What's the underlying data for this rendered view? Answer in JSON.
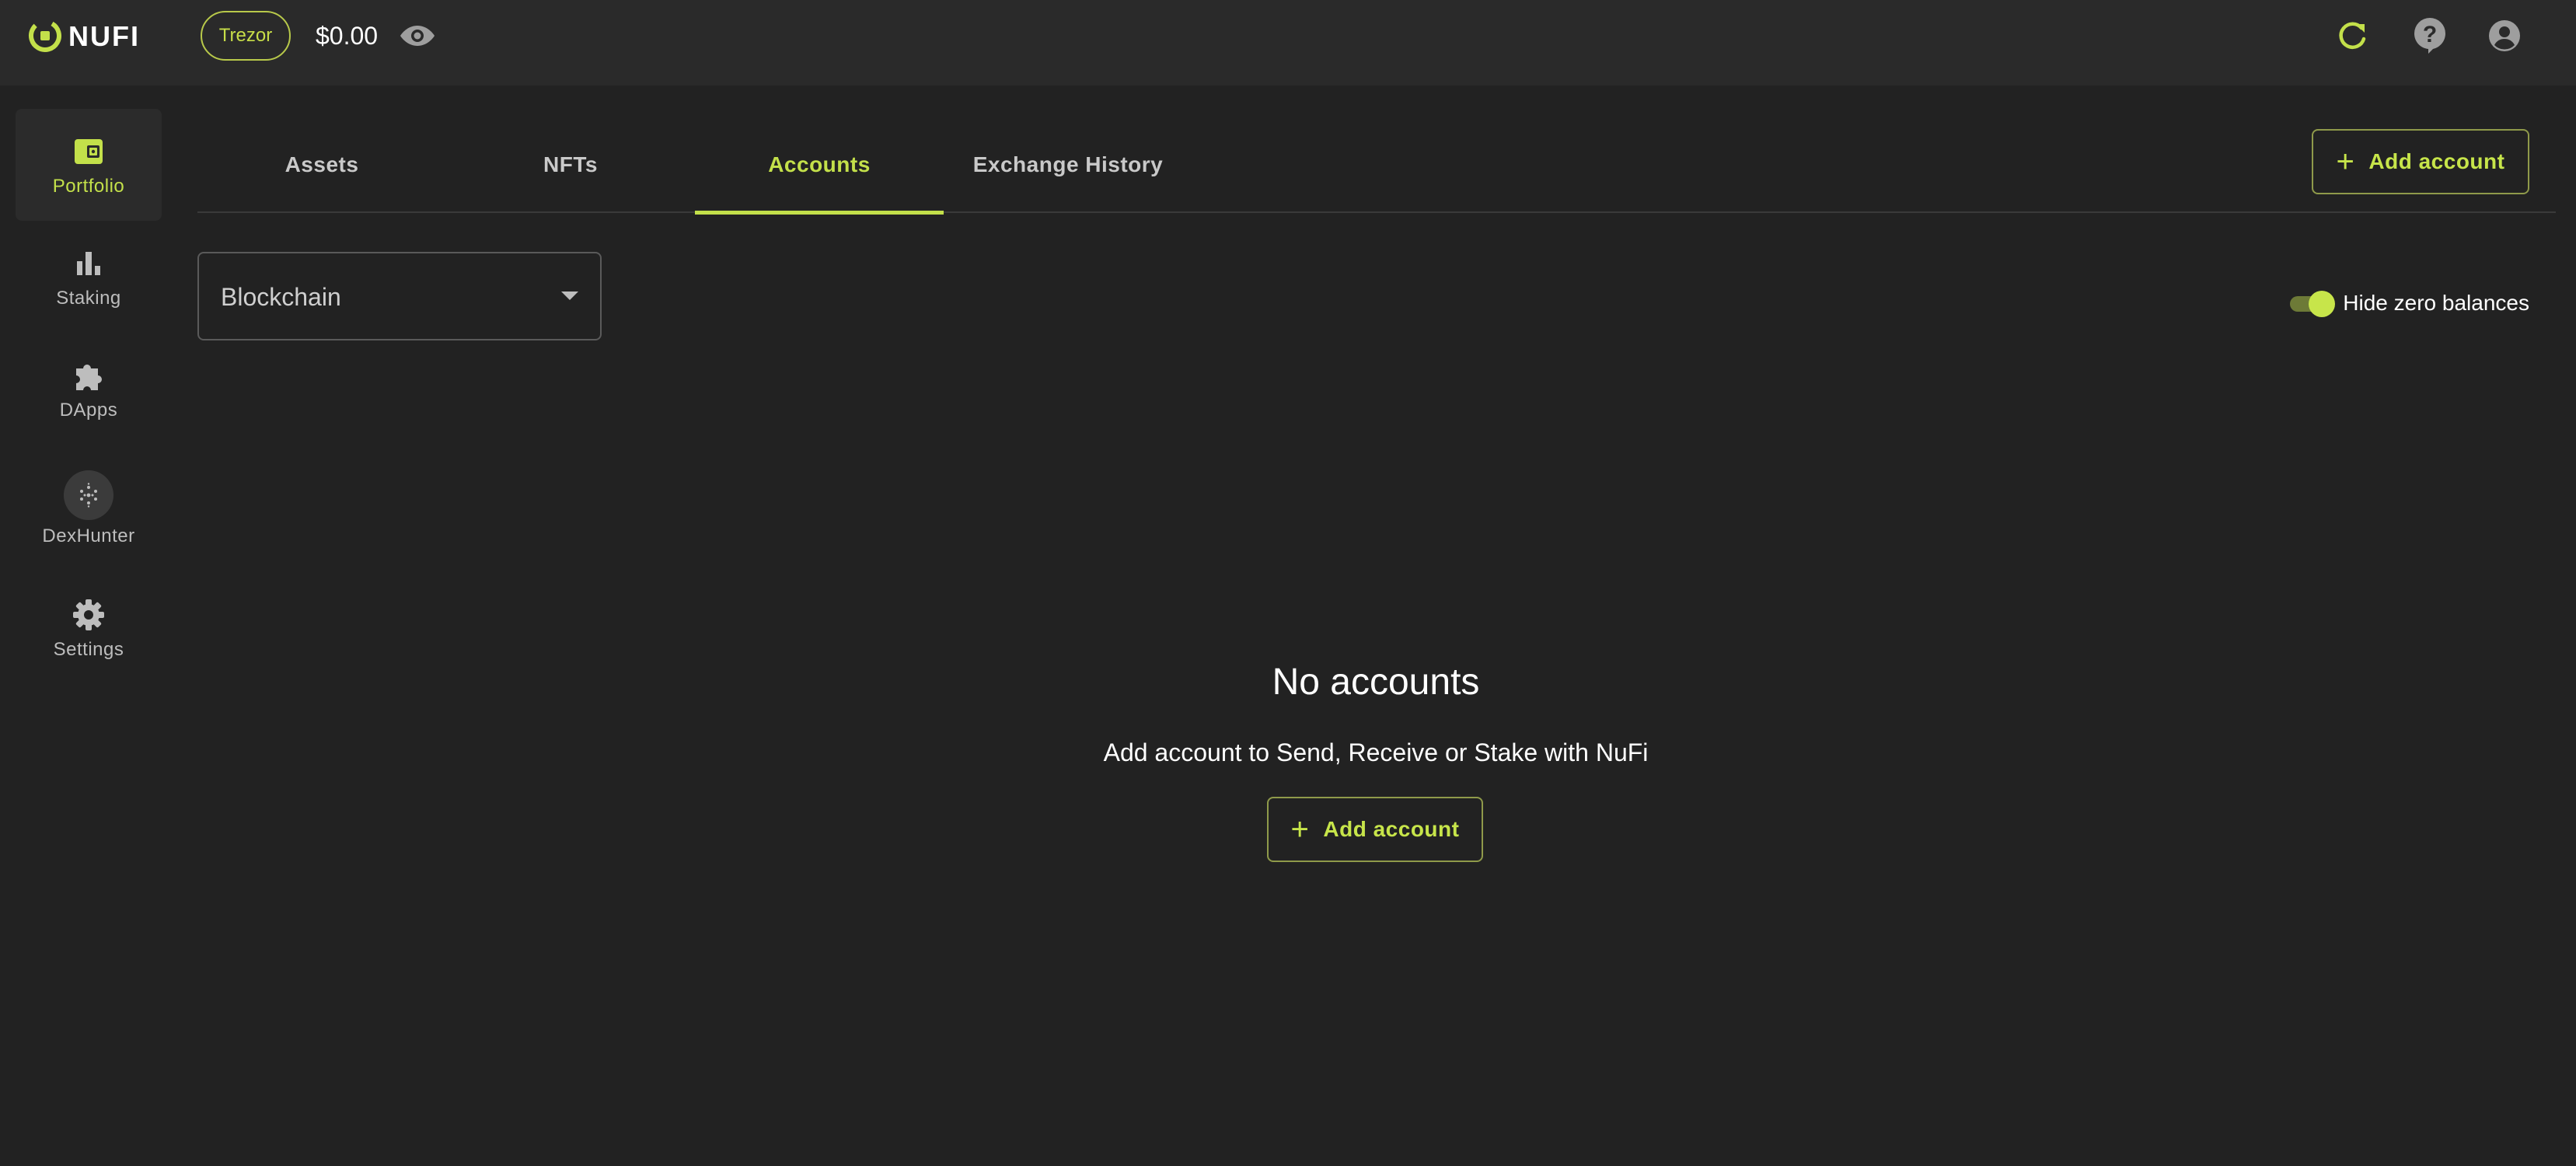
{
  "brand": {
    "name": "NUFI",
    "accent": "#c3e04a"
  },
  "header": {
    "wallet_type": "Trezor",
    "balance": "$0.00",
    "icons": [
      "eye-icon",
      "refresh-icon",
      "help-icon",
      "account-icon"
    ]
  },
  "sidebar": {
    "items": [
      {
        "label": "Portfolio",
        "icon": "wallet-icon",
        "active": true
      },
      {
        "label": "Staking",
        "icon": "bar-chart-icon"
      },
      {
        "label": "DApps",
        "icon": "puzzle-icon"
      },
      {
        "label": "DexHunter",
        "icon": "dexhunter-icon"
      },
      {
        "label": "Settings",
        "icon": "gear-icon"
      }
    ]
  },
  "tabs": [
    {
      "label": "Assets"
    },
    {
      "label": "NFTs"
    },
    {
      "label": "Accounts",
      "active": true
    },
    {
      "label": "Exchange History"
    }
  ],
  "toolbar": {
    "add_account_label": "Add account"
  },
  "filters": {
    "blockchain_label": "Blockchain",
    "hide_zero_label": "Hide zero balances",
    "hide_zero_on": true
  },
  "empty_state": {
    "title": "No accounts",
    "subtitle": "Add account to Send, Receive or Stake with NuFi",
    "button_label": "Add account"
  }
}
